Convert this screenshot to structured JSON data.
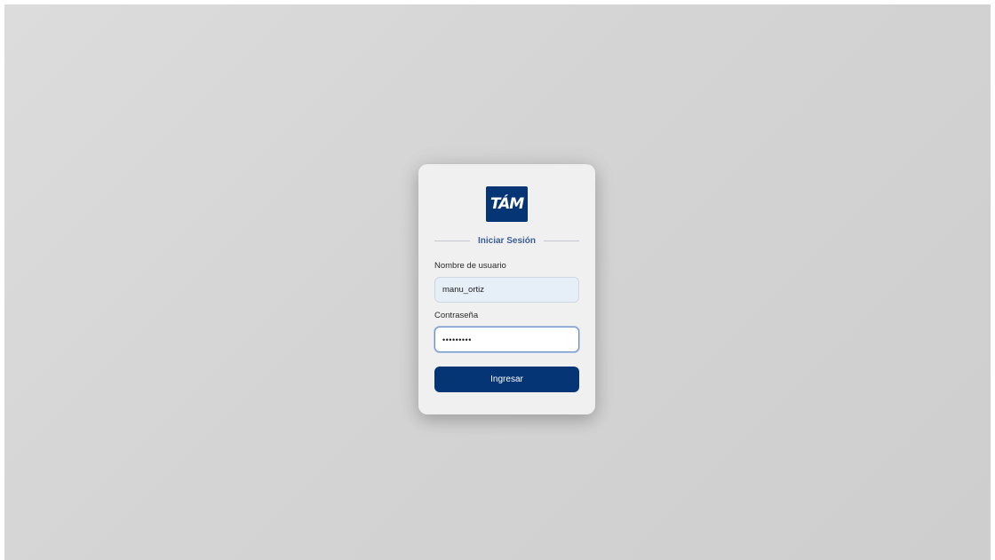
{
  "login": {
    "logo_text": "TÁM",
    "title": "Iniciar Sesión",
    "username_label": "Nombre de usuario",
    "username_value": "manu_ortiz",
    "password_label": "Contraseña",
    "password_value": "•••••••••",
    "submit_label": "Ingresar"
  },
  "colors": {
    "brand_blue": "#063576",
    "title_blue": "#3b5f99",
    "card_bg": "#f0f0f0",
    "page_bg": "#d5d5d5"
  }
}
